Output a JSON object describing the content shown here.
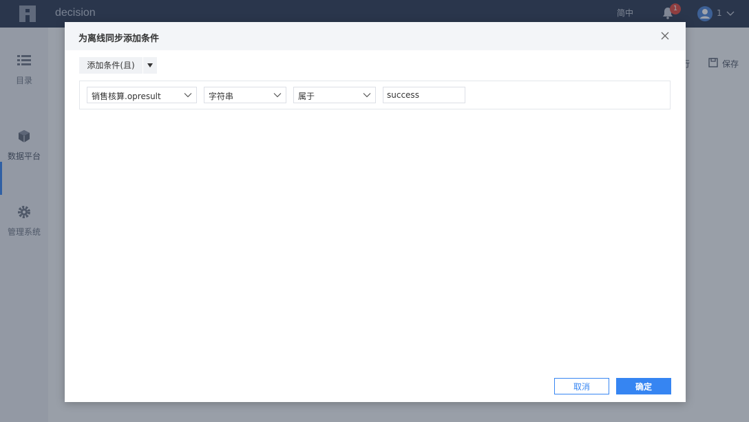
{
  "app": {
    "title": "decision",
    "language_label": "简中",
    "notification_count": "1",
    "user_name": "1"
  },
  "sidebar": {
    "items": [
      {
        "label": "目录",
        "icon": "list-icon"
      },
      {
        "label": "数据平台",
        "icon": "cube-icon"
      },
      {
        "label": "管理系统",
        "icon": "gear-icon"
      }
    ],
    "active_index": 1
  },
  "toolbar": {
    "run_label": "行",
    "save_label": "保存"
  },
  "dialog": {
    "title": "为离线同步添加条件",
    "add_condition_label": "添加条件(且)",
    "condition": {
      "field": "销售核算.opresult",
      "type": "字符串",
      "operator": "属于",
      "value": "success"
    },
    "cancel_label": "取消",
    "ok_label": "确定"
  },
  "colors": {
    "accent": "#3685f2",
    "topbar": "#2b3a52",
    "badge": "#e2483d"
  }
}
